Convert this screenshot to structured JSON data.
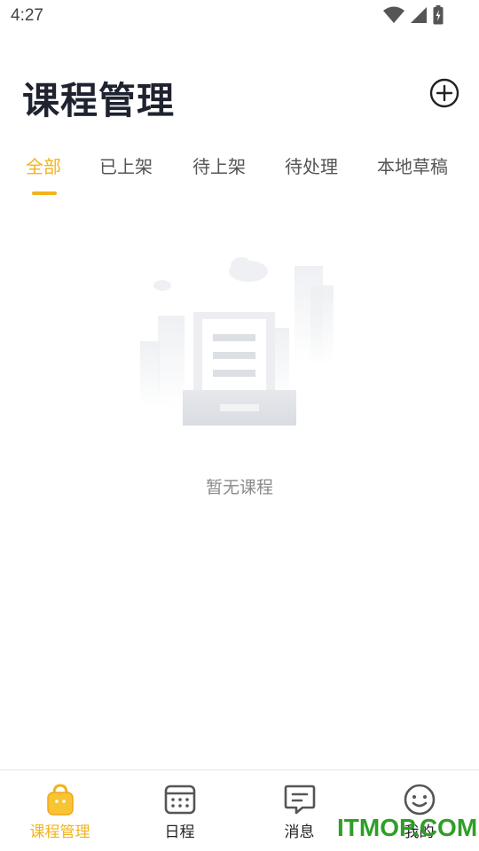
{
  "status_bar": {
    "time": "4:27"
  },
  "header": {
    "title": "课程管理"
  },
  "tabs": [
    {
      "label": "全部",
      "active": true
    },
    {
      "label": "已上架",
      "active": false
    },
    {
      "label": "待上架",
      "active": false
    },
    {
      "label": "待处理",
      "active": false
    },
    {
      "label": "本地草稿",
      "active": false
    }
  ],
  "empty_state": {
    "text": "暂无课程"
  },
  "bottom_nav": [
    {
      "label": "课程管理",
      "icon": "bag-icon",
      "active": true
    },
    {
      "label": "日程",
      "icon": "calendar-icon",
      "active": false
    },
    {
      "label": "消息",
      "icon": "message-icon",
      "active": false
    },
    {
      "label": "我的",
      "icon": "smiley-icon",
      "active": false
    }
  ],
  "watermark": "ITMOP.COM",
  "colors": {
    "accent": "#f2b31b",
    "title": "#1f2330",
    "watermark": "#2f9e27"
  }
}
